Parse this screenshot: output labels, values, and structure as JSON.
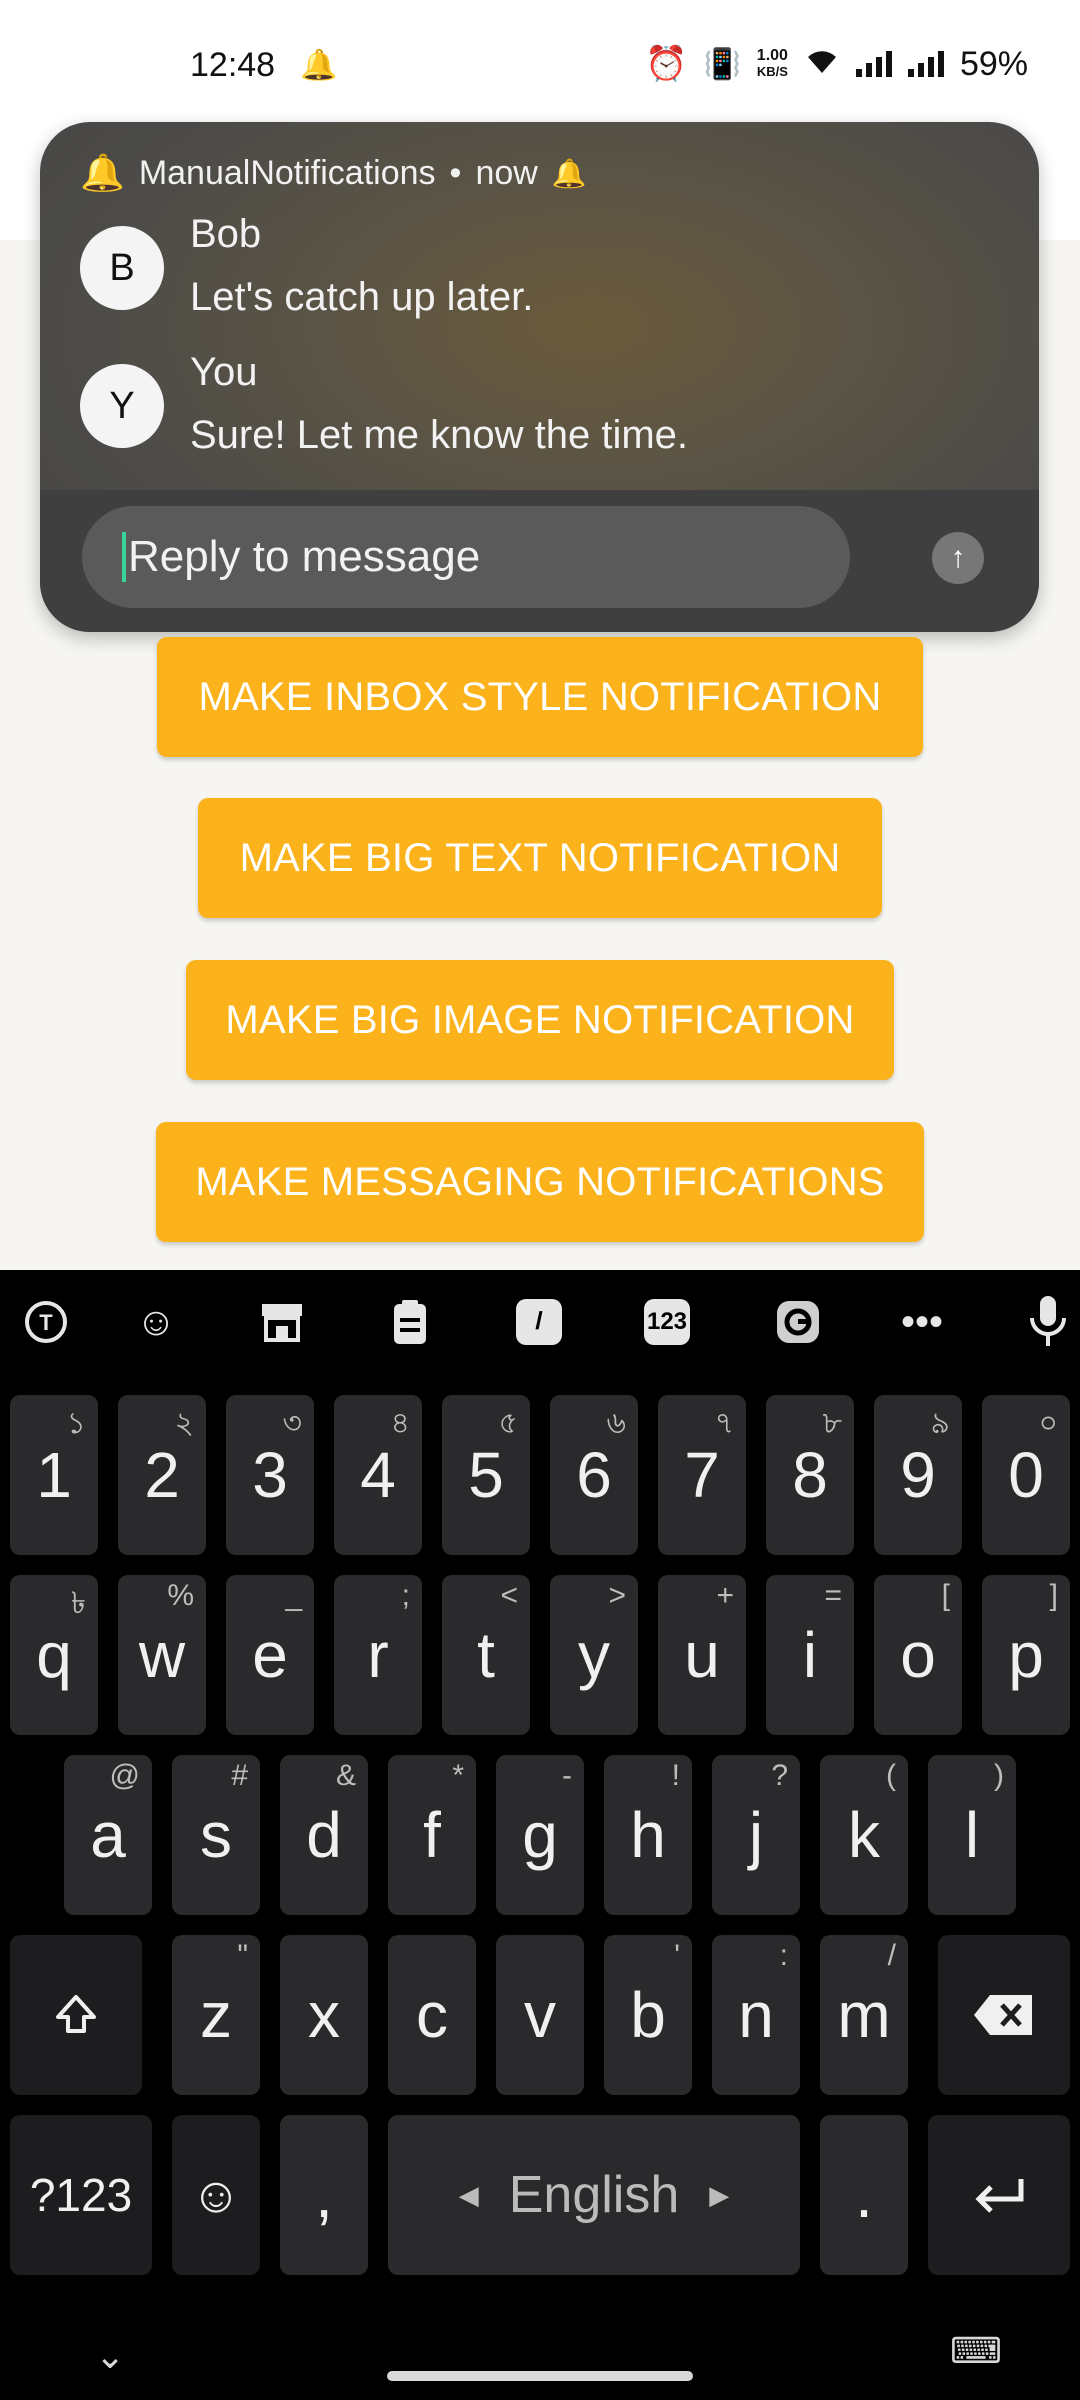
{
  "status_bar": {
    "time": "12:48",
    "net_speed_value": "1.00",
    "net_speed_unit": "KB/S",
    "battery": "59%"
  },
  "notification": {
    "app_name": "ManualNotifications",
    "separator": "•",
    "time": "now",
    "messages": [
      {
        "avatar": "B",
        "name": "Bob",
        "text": "Let's catch up later."
      },
      {
        "avatar": "Y",
        "name": "You",
        "text": "Sure! Let me know the time."
      }
    ],
    "reply_placeholder": "Reply to message"
  },
  "app": {
    "buttons": [
      "MAKE INBOX STYLE NOTIFICATION",
      "MAKE BIG TEXT NOTIFICATION",
      "MAKE BIG IMAGE NOTIFICATION",
      "MAKE MESSAGING NOTIFICATIONS"
    ]
  },
  "keyboard": {
    "toolbar": {
      "numbers_badge": "123"
    },
    "row_numbers": [
      {
        "label": "1",
        "hint": "১"
      },
      {
        "label": "2",
        "hint": "২"
      },
      {
        "label": "3",
        "hint": "৩"
      },
      {
        "label": "4",
        "hint": "৪"
      },
      {
        "label": "5",
        "hint": "৫"
      },
      {
        "label": "6",
        "hint": "৬"
      },
      {
        "label": "7",
        "hint": "৭"
      },
      {
        "label": "8",
        "hint": "৮"
      },
      {
        "label": "9",
        "hint": "৯"
      },
      {
        "label": "0",
        "hint": "০"
      }
    ],
    "row_top": [
      {
        "label": "q",
        "hint": "৳"
      },
      {
        "label": "w",
        "hint": "%"
      },
      {
        "label": "e",
        "hint": "_"
      },
      {
        "label": "r",
        "hint": ";"
      },
      {
        "label": "t",
        "hint": "<"
      },
      {
        "label": "y",
        "hint": ">"
      },
      {
        "label": "u",
        "hint": "+"
      },
      {
        "label": "i",
        "hint": "="
      },
      {
        "label": "o",
        "hint": "["
      },
      {
        "label": "p",
        "hint": "]"
      }
    ],
    "row_middle": [
      {
        "label": "a",
        "hint": "@"
      },
      {
        "label": "s",
        "hint": "#"
      },
      {
        "label": "d",
        "hint": "&"
      },
      {
        "label": "f",
        "hint": "*"
      },
      {
        "label": "g",
        "hint": "-"
      },
      {
        "label": "h",
        "hint": "!"
      },
      {
        "label": "j",
        "hint": "?"
      },
      {
        "label": "k",
        "hint": "("
      },
      {
        "label": "l",
        "hint": ")"
      }
    ],
    "row_bottom": [
      {
        "label": "z",
        "hint": "\""
      },
      {
        "label": "x",
        "hint": ""
      },
      {
        "label": "c",
        "hint": ""
      },
      {
        "label": "v",
        "hint": ""
      },
      {
        "label": "b",
        "hint": "'"
      },
      {
        "label": "n",
        "hint": ":"
      },
      {
        "label": "m",
        "hint": "/"
      }
    ],
    "symbols_key": "?123",
    "comma_key": ",",
    "space_label": "English",
    "period_key": "."
  }
}
